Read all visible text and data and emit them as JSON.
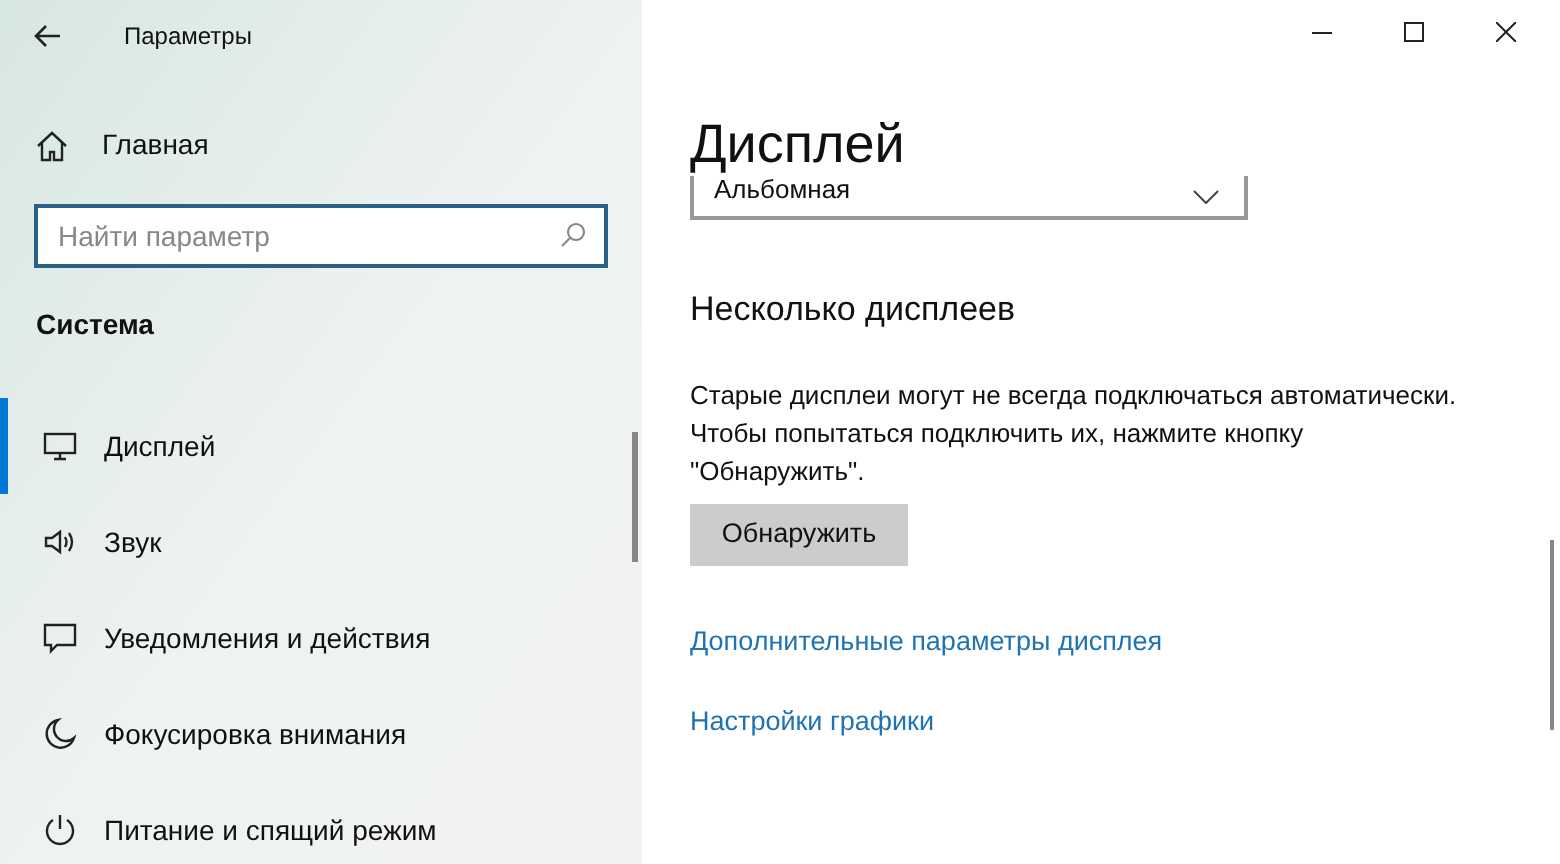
{
  "window": {
    "title": "Параметры"
  },
  "sidebar": {
    "home": "Главная",
    "search": {
      "placeholder": "Найти параметр"
    },
    "section": "Система",
    "items": [
      {
        "kind": "display",
        "label": "Дисплей",
        "selected": true
      },
      {
        "kind": "sound",
        "label": "Звук",
        "selected": false
      },
      {
        "kind": "notifications",
        "label": "Уведомления и действия",
        "selected": false
      },
      {
        "kind": "focus",
        "label": "Фокусировка внимания",
        "selected": false
      },
      {
        "kind": "power",
        "label": "Питание и спящий режим",
        "selected": false
      }
    ]
  },
  "page": {
    "title": "Дисплей",
    "orientation": {
      "value": "Альбомная"
    },
    "section": "Несколько дисплеев",
    "description": "Старые дисплеи могут не всегда подключаться автоматически. Чтобы попытаться подключить их, нажмите кнопку \"Обнаружить\".",
    "button": "Обнаружить",
    "links": [
      "Дополнительные параметры дисплея",
      "Настройки графики"
    ]
  }
}
